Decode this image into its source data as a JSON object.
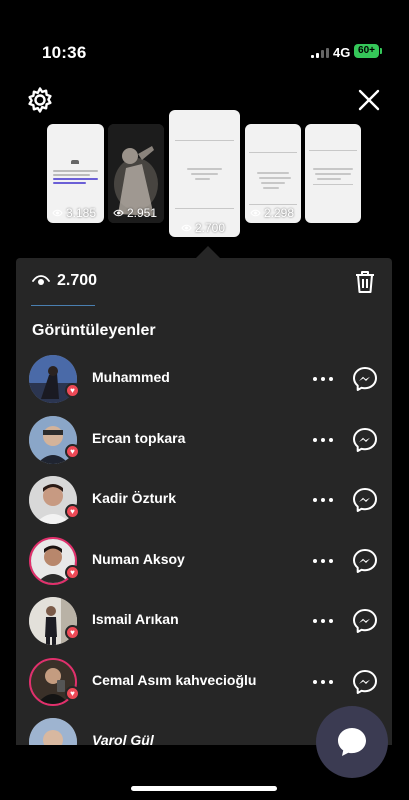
{
  "status": {
    "time": "10:36",
    "network": "4G",
    "battery": "60+"
  },
  "stories": [
    {
      "views": "3.185"
    },
    {
      "views": "2.951"
    },
    {
      "views": "2.700"
    },
    {
      "views": "2.298"
    },
    {
      "views": ""
    }
  ],
  "panel": {
    "view_count": "2.700",
    "section_title": "Görüntüleyenler"
  },
  "viewers": [
    {
      "name": "Muhammed"
    },
    {
      "name": "Ercan topkara"
    },
    {
      "name": "Kadir Özturk"
    },
    {
      "name": "Numan Aksoy"
    },
    {
      "name": "Ismail Arıkan"
    },
    {
      "name": "Cemal Asım kahvecioğlu"
    },
    {
      "name": "Varol Gül"
    }
  ],
  "colors": {
    "accent_heart": "#ed4956",
    "ring": "#e1306c",
    "panel_bg": "#262626"
  }
}
